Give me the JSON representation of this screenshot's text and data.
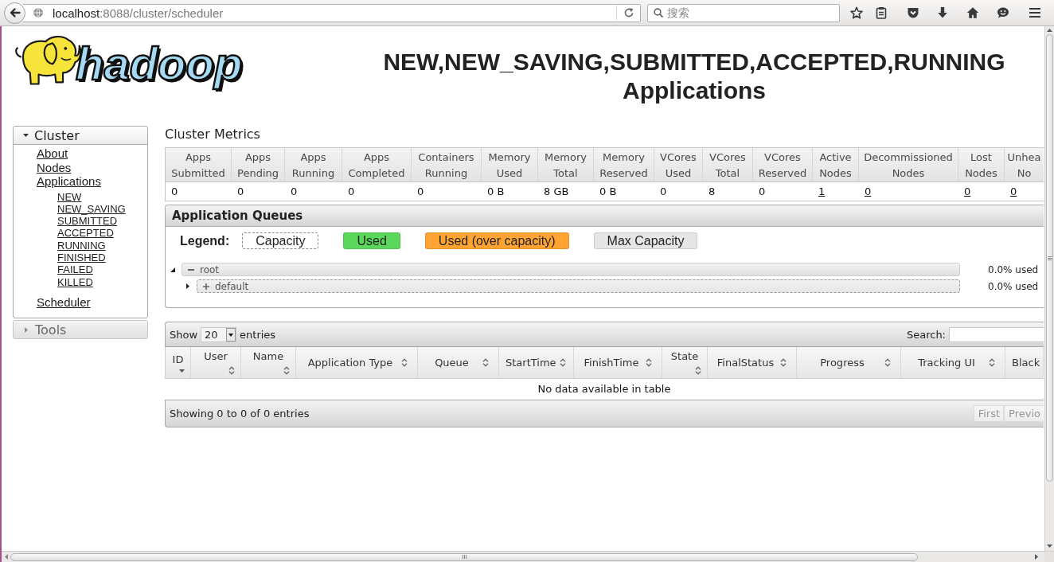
{
  "browser": {
    "address": {
      "host": "localhost",
      "path": ":8088/cluster/scheduler"
    },
    "search": {
      "placeholder": "搜索"
    }
  },
  "logo": {
    "text": "hadoop"
  },
  "page_title": "NEW,NEW_SAVING,SUBMITTED,ACCEPTED,RUNNING Applications",
  "sidebar": [
    {
      "label": "Cluster",
      "expanded": true,
      "children": [
        {
          "label": "About"
        },
        {
          "label": "Nodes"
        },
        {
          "label": "Applications",
          "children": [
            {
              "label": "NEW"
            },
            {
              "label": "NEW_SAVING"
            },
            {
              "label": "SUBMITTED"
            },
            {
              "label": "ACCEPTED"
            },
            {
              "label": "RUNNING"
            },
            {
              "label": "FINISHED"
            },
            {
              "label": "FAILED"
            },
            {
              "label": "KILLED"
            }
          ]
        },
        {
          "label": "Scheduler"
        }
      ]
    },
    {
      "label": "Tools",
      "expanded": false
    }
  ],
  "cluster_metrics": {
    "title": "Cluster Metrics",
    "columns": [
      {
        "label": "Apps Submitted",
        "value": "0",
        "link": false
      },
      {
        "label": "Apps Pending",
        "value": "0",
        "link": false
      },
      {
        "label": "Apps Running",
        "value": "0",
        "link": false
      },
      {
        "label": "Apps Completed",
        "value": "0",
        "link": false
      },
      {
        "label": "Containers Running",
        "value": "0",
        "link": false
      },
      {
        "label": "Memory Used",
        "value": "0 B",
        "link": false
      },
      {
        "label": "Memory Total",
        "value": "8 GB",
        "link": false
      },
      {
        "label": "Memory Reserved",
        "value": "0 B",
        "link": false
      },
      {
        "label": "VCores Used",
        "value": "0",
        "link": false
      },
      {
        "label": "VCores Total",
        "value": "8",
        "link": false
      },
      {
        "label": "VCores Reserved",
        "value": "0",
        "link": false
      },
      {
        "label": "Active Nodes",
        "value": "1",
        "link": true
      },
      {
        "label": "Decommissioned Nodes",
        "value": "0",
        "link": true
      },
      {
        "label": "Lost Nodes",
        "value": "0",
        "link": true
      },
      {
        "label": "Unhea No",
        "value": "0",
        "link": true
      }
    ]
  },
  "application_queues": {
    "title": "Application Queues",
    "legend_label": "Legend:",
    "legend": [
      {
        "label": "Capacity",
        "kind": "dashed",
        "color": "#ffffff"
      },
      {
        "label": "Used",
        "kind": "solid",
        "color": "#5bd75b"
      },
      {
        "label": "Used (over capacity)",
        "kind": "solid",
        "color": "#ffa333"
      },
      {
        "label": "Max Capacity",
        "kind": "solid",
        "color": "#e6e6e6"
      }
    ],
    "queues": [
      {
        "name": "root",
        "expanded": true,
        "usage": "0.0% used",
        "children": [
          {
            "name": "default",
            "expanded": false,
            "usage": "0.0% used"
          }
        ]
      }
    ]
  },
  "applications": {
    "show_label": "Show",
    "page_size": "20",
    "entries_label": "entries",
    "search_label": "Search:",
    "columns": [
      {
        "label": "ID",
        "sortable": true,
        "sorted": true
      },
      {
        "label": "User",
        "sortable": true,
        "sorted": false
      },
      {
        "label": "Name",
        "sortable": true,
        "sorted": false
      },
      {
        "label": "Application Type",
        "sortable": true,
        "sorted": false
      },
      {
        "label": "Queue",
        "sortable": true,
        "sorted": false
      },
      {
        "label": "StartTime",
        "sortable": true,
        "sorted": false
      },
      {
        "label": "FinishTime",
        "sortable": true,
        "sorted": false
      },
      {
        "label": "State",
        "sortable": true,
        "sorted": false
      },
      {
        "label": "FinalStatus",
        "sortable": true,
        "sorted": false
      },
      {
        "label": "Progress",
        "sortable": true,
        "sorted": false
      },
      {
        "label": "Tracking UI",
        "sortable": true,
        "sorted": false
      },
      {
        "label": "Black",
        "sortable": false,
        "sorted": false
      }
    ],
    "empty_text": "No data available in table",
    "info": "Showing 0 to 0 of 0 entries",
    "paging": [
      {
        "label": "First",
        "disabled": true
      },
      {
        "label": "Previo",
        "disabled": true
      }
    ]
  }
}
